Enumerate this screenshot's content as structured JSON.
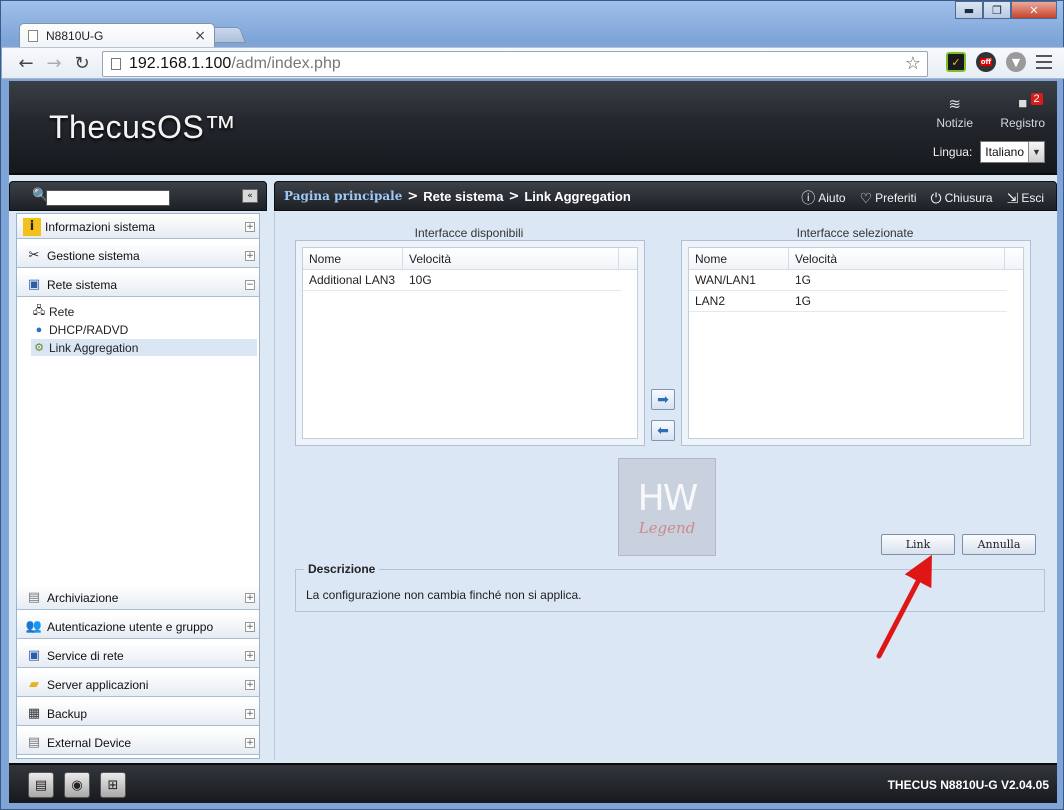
{
  "browser": {
    "tab_title": "N8810U-G",
    "tab_close": "×",
    "url_host": "192.168.1.100",
    "url_path": "/adm/index.php",
    "win_min": "▬",
    "win_max": "❐",
    "win_close": "✕",
    "ext_badge": "off"
  },
  "header": {
    "brand": "ThecusOS™",
    "news_label": "Notizie",
    "log_label": "Registro",
    "log_count": "2",
    "language_label": "Lingua:",
    "language_value": "Italiano"
  },
  "sidebar": {
    "groups_top": [
      {
        "label": "Informazioni sistema",
        "icon": "info-icon",
        "toggle": "+"
      },
      {
        "label": "Gestione sistema",
        "icon": "tools-icon",
        "toggle": "+"
      },
      {
        "label": "Rete sistema",
        "icon": "network-icon",
        "toggle": "−"
      }
    ],
    "sub_items": [
      {
        "label": "Rete",
        "icon": "network-cable-icon"
      },
      {
        "label": "DHCP/RADVD",
        "icon": "globe-icon"
      },
      {
        "label": "Link Aggregation",
        "icon": "link-aggregation-icon"
      }
    ],
    "groups_bottom": [
      {
        "label": "Archiviazione",
        "icon": "storage-icon",
        "toggle": "+"
      },
      {
        "label": "Autenticazione utente e gruppo",
        "icon": "users-icon",
        "toggle": "+"
      },
      {
        "label": "Service di rete",
        "icon": "network-service-icon",
        "toggle": "+"
      },
      {
        "label": "Server applicazioni",
        "icon": "folder-app-icon",
        "toggle": "+"
      },
      {
        "label": "Backup",
        "icon": "backup-icon",
        "toggle": "+"
      },
      {
        "label": "External Device",
        "icon": "external-device-icon",
        "toggle": "+"
      }
    ]
  },
  "breadcrumb": {
    "home": "Pagina principale",
    "sep": ">",
    "level1": "Rete sistema",
    "level2": "Link Aggregation"
  },
  "actions": {
    "help": "Aiuto",
    "favorites": "Preferiti",
    "shutdown": "Chiusura",
    "logout": "Esci"
  },
  "available": {
    "title": "Interfacce disponibili",
    "columns": [
      "Nome",
      "Velocità"
    ],
    "rows": [
      {
        "name": "Additional LAN3",
        "speed": "10G"
      }
    ]
  },
  "selected": {
    "title": "Interfacce selezionate",
    "columns": [
      "Nome",
      "Velocità"
    ],
    "rows": [
      {
        "name": "WAN/LAN1",
        "speed": "1G"
      },
      {
        "name": "LAN2",
        "speed": "1G"
      }
    ]
  },
  "watermark": {
    "big": "HW",
    "small": "Legend"
  },
  "buttons": {
    "link": "Link",
    "cancel": "Annulla"
  },
  "description": {
    "legend": "Descrizione",
    "text": "La configurazione non cambia finché non si applica."
  },
  "footer": {
    "version": "THECUS N8810U-G V2.04.05"
  }
}
